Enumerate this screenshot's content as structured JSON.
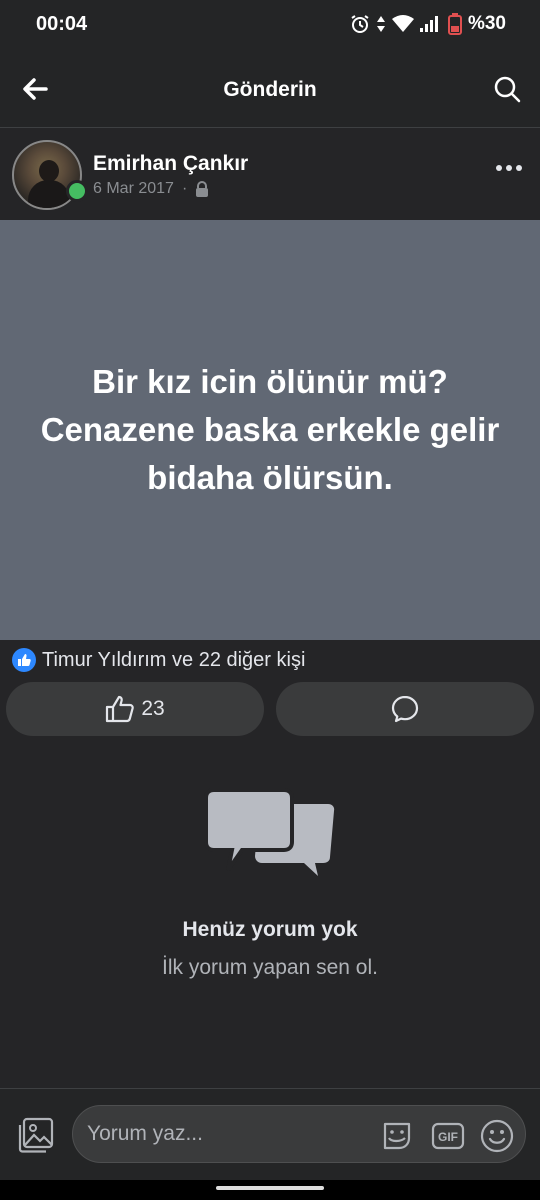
{
  "status_bar": {
    "time": "00:04",
    "battery_percent": "%30",
    "icons": [
      "alarm-icon",
      "data-arrows-icon",
      "wifi-icon",
      "signal-icon",
      "battery-icon"
    ]
  },
  "header": {
    "title": "Gönderin",
    "back_icon": "arrow-left-icon",
    "search_icon": "search-icon"
  },
  "post": {
    "author": "Emirhan Çankır",
    "date": "6 Mar 2017",
    "separator": "·",
    "privacy_icon": "lock-icon",
    "online": true,
    "text_lines": [
      "Bir kız icin ölünür mü?",
      "Cenazene baska erkekle gelir",
      "bidaha ölürsün."
    ],
    "background_color": "#616874"
  },
  "reactions": {
    "summary": "Timur Yıldırım ve 22 diğer kişi",
    "like_count": "23"
  },
  "comments": {
    "empty_title": "Henüz yorum yok",
    "empty_subtitle": "İlk yorum yapan sen ol."
  },
  "composer": {
    "placeholder": "Yorum yaz...",
    "icons": [
      "photo-icon",
      "sticker-icon",
      "gif-icon",
      "emoji-icon"
    ]
  },
  "colors": {
    "background": "#252527",
    "bar": "#242526",
    "like_blue": "#2d88ff",
    "online_green": "#45bd62"
  }
}
